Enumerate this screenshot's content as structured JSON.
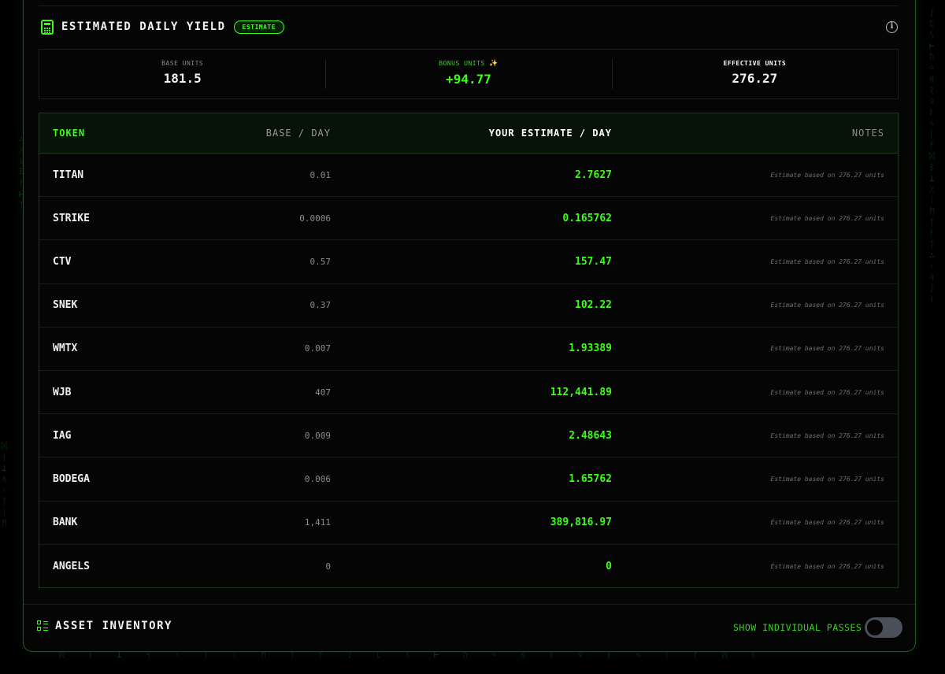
{
  "yield": {
    "title": "ESTIMATED DAILY YIELD",
    "badge": "ESTIMATE",
    "info_icon": "i"
  },
  "stats": {
    "base_label": "BASE UNITS",
    "base_value": "181.5",
    "bonus_label": "BONUS UNITS",
    "bonus_icon": "✨",
    "bonus_value": "+94.77",
    "effective_label": "EFFECTIVE UNITS",
    "effective_value": "276.27"
  },
  "table": {
    "headers": {
      "token": "TOKEN",
      "base": "BASE / DAY",
      "estimate": "YOUR ESTIMATE / DAY",
      "notes": "NOTES"
    },
    "rows": [
      {
        "token": "TITAN",
        "base": "0.01",
        "estimate": "2.7627",
        "note": "Estimate based on 276.27 units"
      },
      {
        "token": "STRIKE",
        "base": "0.0006",
        "estimate": "0.165762",
        "note": "Estimate based on 276.27 units"
      },
      {
        "token": "CTV",
        "base": "0.57",
        "estimate": "157.47",
        "note": "Estimate based on 276.27 units"
      },
      {
        "token": "SNEK",
        "base": "0.37",
        "estimate": "102.22",
        "note": "Estimate based on 276.27 units"
      },
      {
        "token": "WMTX",
        "base": "0.007",
        "estimate": "1.93389",
        "note": "Estimate based on 276.27 units"
      },
      {
        "token": "WJB",
        "base": "407",
        "estimate": "112,441.89",
        "note": "Estimate based on 276.27 units"
      },
      {
        "token": "IAG",
        "base": "0.009",
        "estimate": "2.48643",
        "note": "Estimate based on 276.27 units"
      },
      {
        "token": "BODEGA",
        "base": "0.006",
        "estimate": "1.65762",
        "note": "Estimate based on 276.27 units"
      },
      {
        "token": "BANK",
        "base": "1,411",
        "estimate": "389,816.97",
        "note": "Estimate based on 276.27 units"
      },
      {
        "token": "ANGELS",
        "base": "0",
        "estimate": "0",
        "note": "Estimate based on 276.27 units"
      }
    ]
  },
  "assets": {
    "title": "ASSET INVENTORY",
    "toggle_label": "SHOW INDIVIDUAL PASSES",
    "toggle_on": false
  },
  "colors": {
    "accent": "#39ff14",
    "background": "#000000",
    "panel_border": "#1f5a1f"
  }
}
